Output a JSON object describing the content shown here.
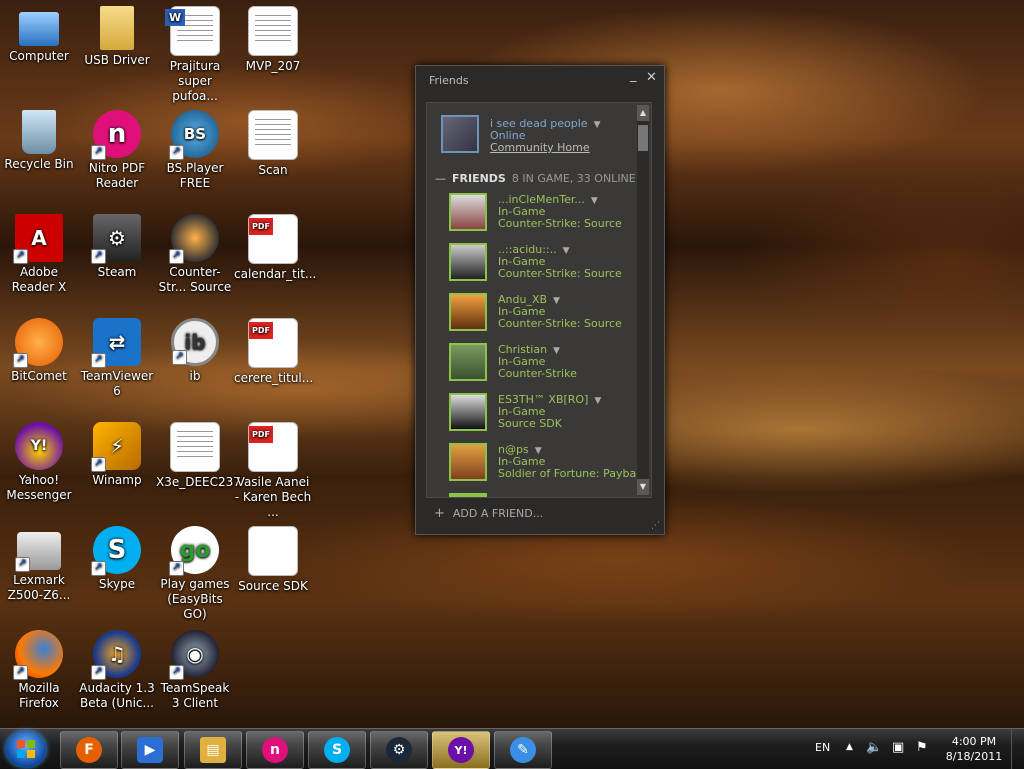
{
  "desktop": {
    "icons": [
      {
        "label": "Computer"
      },
      {
        "label": "USB Driver"
      },
      {
        "label": "Prajitura super pufoa..."
      },
      {
        "label": "MVP_207"
      },
      {
        "label": "Recycle Bin"
      },
      {
        "label": "Nitro PDF Reader"
      },
      {
        "label": "BS.Player FREE"
      },
      {
        "label": "Scan"
      },
      {
        "label": "Adobe Reader X"
      },
      {
        "label": "Steam"
      },
      {
        "label": "Counter-Str... Source"
      },
      {
        "label": "calendar_tit..."
      },
      {
        "label": "BitComet"
      },
      {
        "label": "TeamViewer 6"
      },
      {
        "label": "ib"
      },
      {
        "label": "cerere_titul..."
      },
      {
        "label": "Yahoo! Messenger"
      },
      {
        "label": "Winamp"
      },
      {
        "label": "X3e_DEEC237"
      },
      {
        "label": "Vasile Aanei - Karen Bech ..."
      },
      {
        "label": "Lexmark Z500-Z6..."
      },
      {
        "label": "Skype"
      },
      {
        "label": "Play games (EasyBits GO)"
      },
      {
        "label": "Source SDK"
      },
      {
        "label": "Mozilla Firefox"
      },
      {
        "label": "Audacity 1.3 Beta (Unic..."
      },
      {
        "label": "TeamSpeak 3 Client"
      }
    ],
    "icon_badges": {
      "nitro": "n",
      "bsplayer": "BS",
      "ib": "ib",
      "pdf": "PDF",
      "go": "go",
      "yahoo": "Y!",
      "word": "W"
    }
  },
  "steam": {
    "title": "Friends",
    "minimize": "_",
    "close": "✕",
    "me": {
      "name": "i see dead people",
      "status": "Online",
      "link": "Community Home"
    },
    "friends_header": {
      "collapse": "—",
      "label": "FRIENDS",
      "count": "8 IN GAME, 33 ONLINE"
    },
    "friends": [
      {
        "name": "...inCleMenTer...",
        "status": "In-Game",
        "game": "Counter-Strike: Source"
      },
      {
        "name": "..::acidu::..",
        "status": "In-Game",
        "game": "Counter-Strike: Source"
      },
      {
        "name": "Andu_XB",
        "status": "In-Game",
        "game": "Counter-Strike: Source"
      },
      {
        "name": "Christian",
        "status": "In-Game",
        "game": "Counter-Strike"
      },
      {
        "name": "ES3TH™ XB[RO]",
        "status": "In-Game",
        "game": "Source SDK"
      },
      {
        "name": "n@ps",
        "status": "In-Game",
        "game": "Soldier of Fortune: Payback"
      }
    ],
    "add_friend": "ADD A FRIEND...",
    "add_icon": "+"
  },
  "taskbar": {
    "language": "EN",
    "time": "4:00 PM",
    "date": "8/18/2011",
    "items": [
      {
        "name": "firefox",
        "glyph": "F",
        "color": "#e66000"
      },
      {
        "name": "media",
        "glyph": "▶",
        "color": "#2b6fd6"
      },
      {
        "name": "explorer",
        "glyph": "▤",
        "color": "#e0b040"
      },
      {
        "name": "nitro",
        "glyph": "n",
        "color": "#e0107a"
      },
      {
        "name": "skype",
        "glyph": "S",
        "color": "#00aff0"
      },
      {
        "name": "steam",
        "glyph": "⚙",
        "color": "#1b2838"
      },
      {
        "name": "yahoo",
        "glyph": "Y!",
        "color": "#6b0fa8"
      },
      {
        "name": "paint",
        "glyph": "✎",
        "color": "#3a8ee6"
      }
    ]
  }
}
